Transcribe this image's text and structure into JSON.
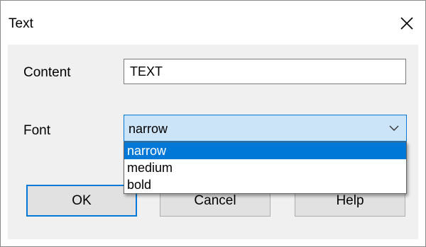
{
  "window": {
    "title": "Text"
  },
  "form": {
    "content_label": "Content",
    "content_value": "TEXT",
    "font_label": "Font",
    "font_selected": "narrow",
    "font_options": [
      "narrow",
      "medium",
      "bold"
    ],
    "highlighted_option_index": 0
  },
  "buttons": {
    "ok": "OK",
    "cancel": "Cancel",
    "help": "Help"
  },
  "icons": {
    "close": "close-icon",
    "dropdown": "chevron-down-icon"
  },
  "colors": {
    "accent": "#0078d7",
    "combo_bg": "#cce4f7",
    "client_bg": "#f0f0f0"
  }
}
